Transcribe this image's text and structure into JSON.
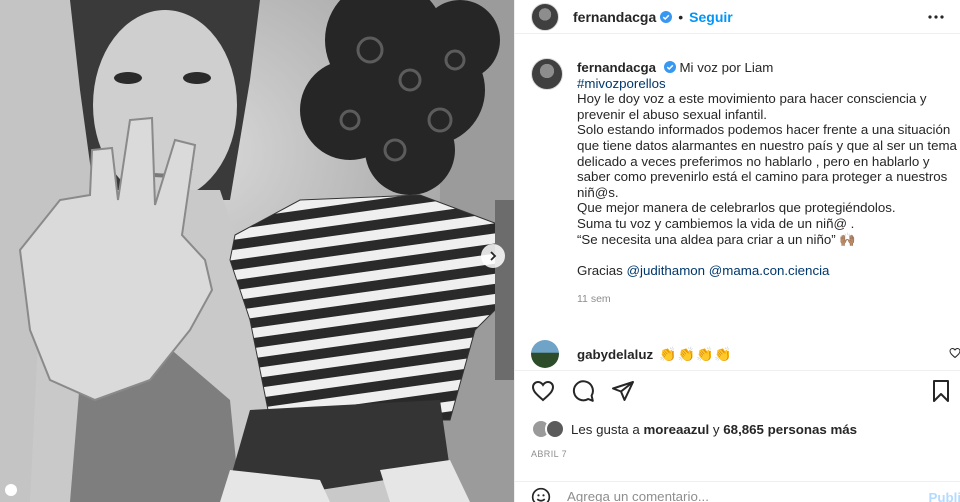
{
  "post": {
    "author": "fernandacga",
    "follow_label": "Seguir",
    "dot": "•",
    "caption_title": "Mi voz por Liam",
    "hashtag": "#mivozporellos",
    "caption_lines": [
      "Hoy le doy voz a este movimiento para hacer consciencia y",
      "prevenir el abuso sexual infantil.",
      "Solo estando informados podemos hacer frente a una situación",
      "que tiene datos alarmantes en nuestro país y que al ser un tema",
      "delicado a veces preferimos no hablarlo , pero en hablarlo y",
      "saber como prevenirlo está el camino para proteger a nuestros",
      "niñ@s.",
      "Que mejor manera de celebrarlos que protegiéndolos.",
      "Suma tu voz y cambiemos la vida de un niñ@ .",
      "“Se necesita una aldea para criar a un niño” 🙌🏽"
    ],
    "thanks_prefix": "Gracias ",
    "mention_1": "@judithamon",
    "mention_2": "@mama.con.ciencia",
    "time_ago": "11 sem",
    "date": "ABRIL 7"
  },
  "comment": {
    "user": "gabydelaluz",
    "text": "👏👏👏👏"
  },
  "likes": {
    "prefix": "Les gusta a ",
    "user": "moreaazul",
    "middle": " y ",
    "count": "68,865 personas más"
  },
  "add_comment": {
    "placeholder": "Agrega un comentario...",
    "publish": "Publicar"
  },
  "icons": {
    "verified": "verified-badge-icon",
    "more": "more-options-icon",
    "like": "heart-icon",
    "comment": "comment-bubble-icon",
    "share": "paper-plane-icon",
    "save": "bookmark-icon",
    "emoji": "smiley-icon",
    "next": "chevron-right-icon"
  },
  "colors": {
    "link": "#0095f6",
    "mention": "#00376b",
    "muted": "#8e8e8e",
    "publish_disabled": "#b3dbff"
  }
}
